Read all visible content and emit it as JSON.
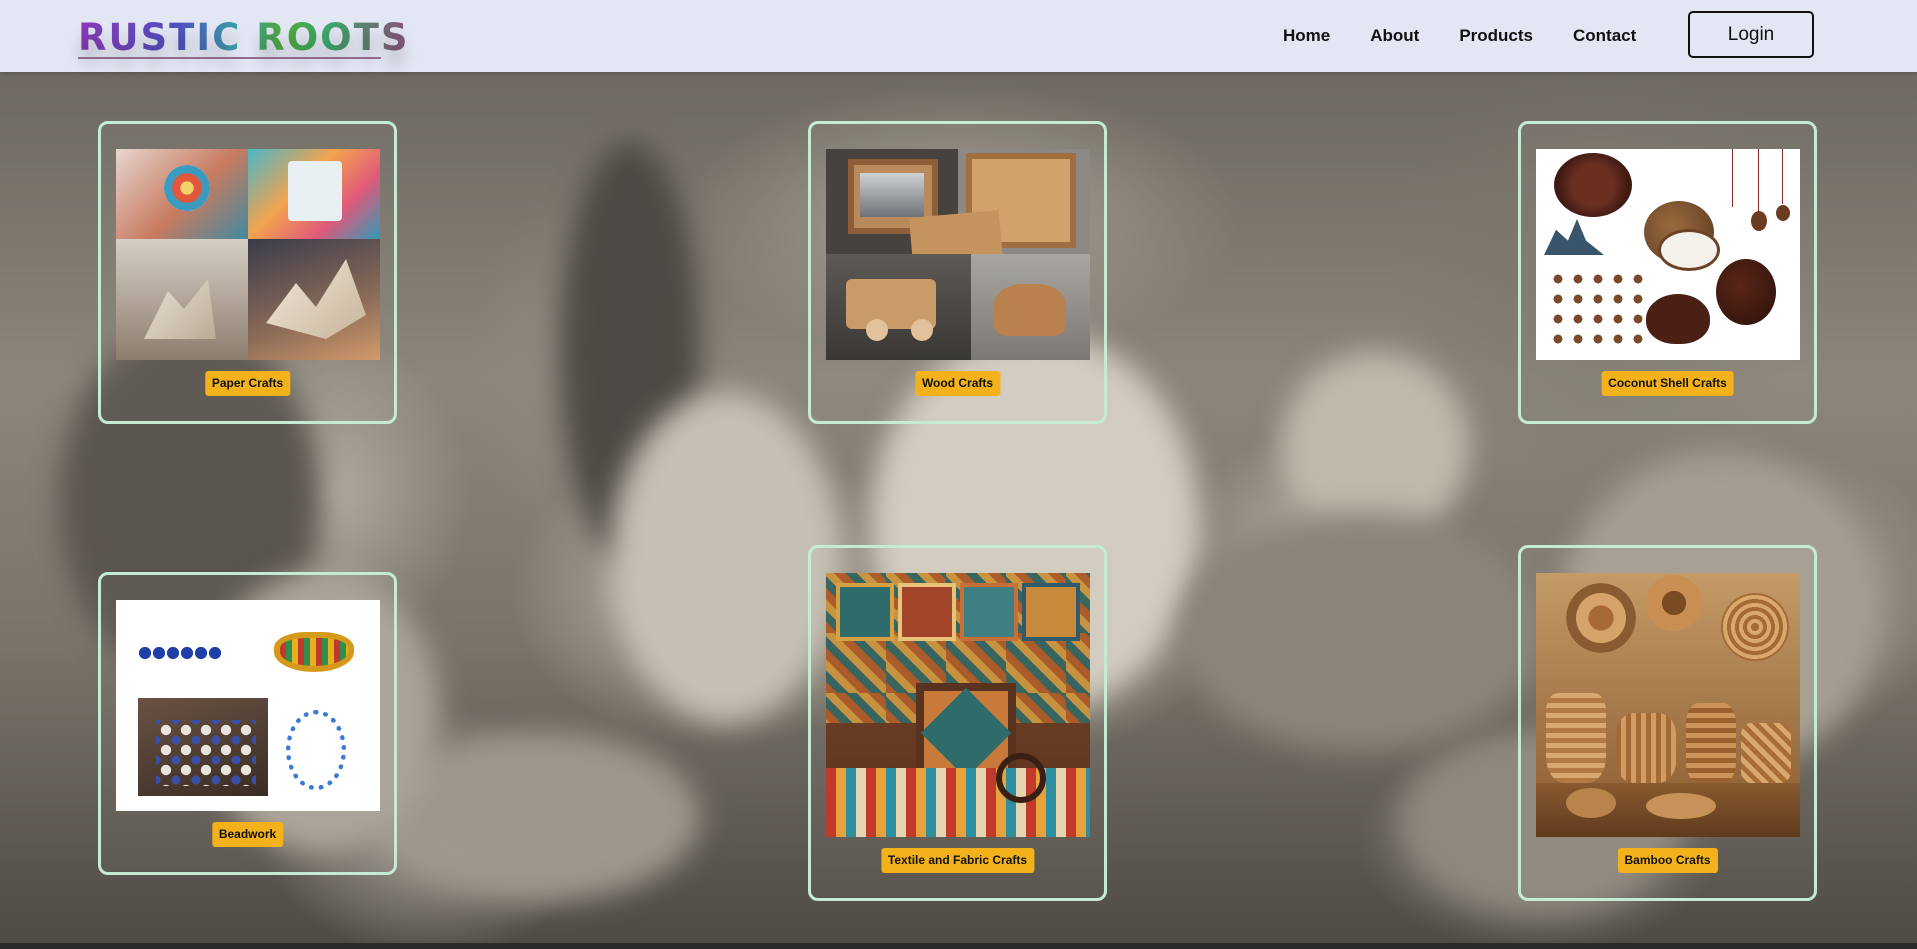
{
  "header": {
    "logo": "RUSTIC ROOTS",
    "nav": [
      "Home",
      "About",
      "Products",
      "Contact"
    ],
    "login_label": "Login"
  },
  "crafts": [
    {
      "label": "Paper Crafts",
      "image": "paper-crafts-collage"
    },
    {
      "label": "Wood Crafts",
      "image": "wood-crafts-collage"
    },
    {
      "label": "Coconut Shell Crafts",
      "image": "coconut-shell-crafts"
    },
    {
      "label": "Beadwork",
      "image": "beadwork-collage"
    },
    {
      "label": "Textile and Fabric Crafts",
      "image": "textile-fabric-crafts"
    },
    {
      "label": "Bamboo Crafts",
      "image": "bamboo-crafts"
    }
  ],
  "colors": {
    "header_bg": "#e3e7f3",
    "card_border": "#c3ecd3",
    "label_bg": "#f3b21b"
  }
}
